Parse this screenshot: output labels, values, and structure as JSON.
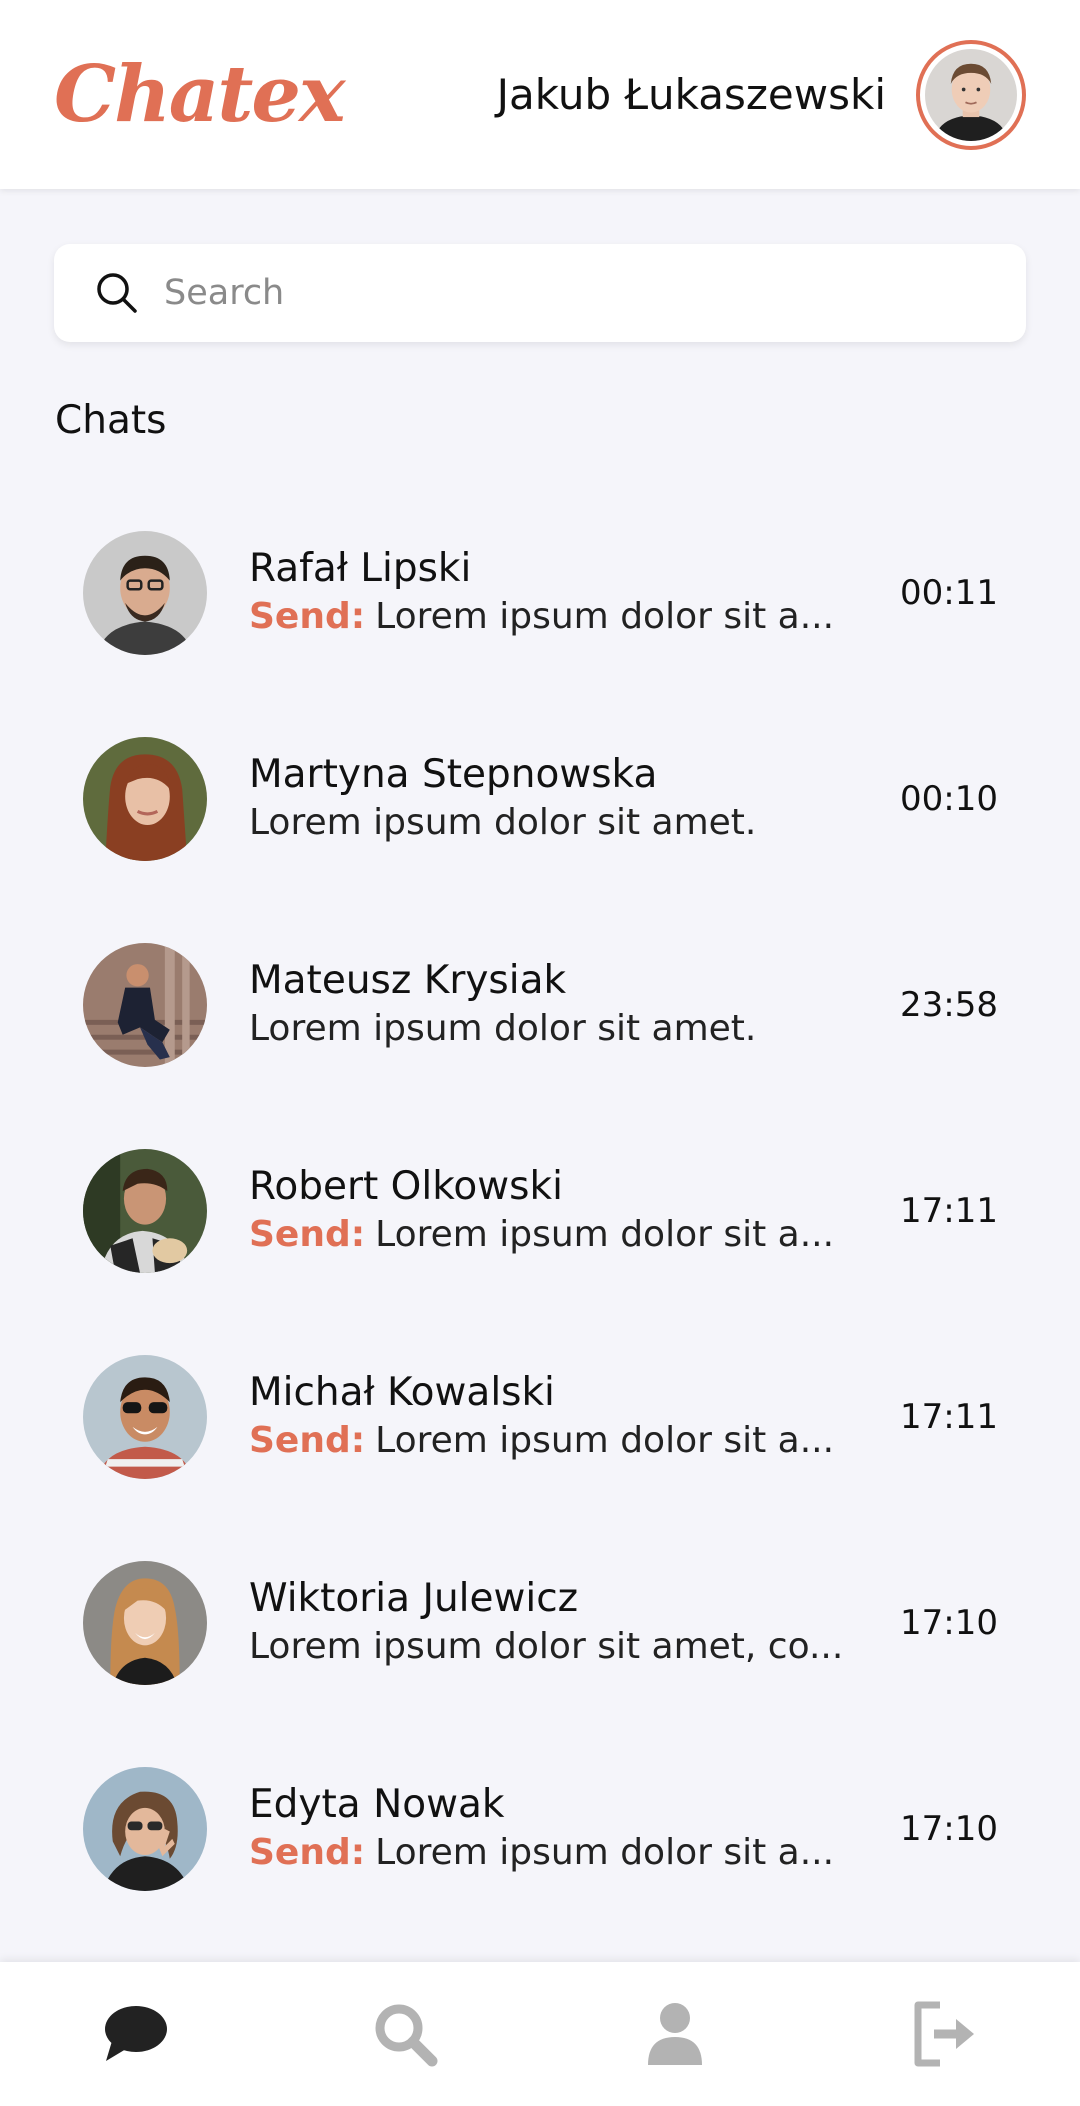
{
  "app": {
    "logo": "Chatex"
  },
  "colors": {
    "accent": "#e07055",
    "background": "#f5f5fa",
    "nav_active": "#222222",
    "nav_inactive": "#b3b3b3"
  },
  "user": {
    "name": "Jakub Łukaszewski",
    "avatar_icon": "profile-avatar"
  },
  "search": {
    "placeholder": "Search",
    "icon": "search-icon"
  },
  "section": {
    "title": "Chats"
  },
  "chats": [
    {
      "name": "Rafał Lipski",
      "prefix": "Send:",
      "preview": "Lorem ipsum dolor sit a...",
      "time": "00:11"
    },
    {
      "name": "Martyna Stepnowska",
      "prefix": "",
      "preview": "Lorem ipsum dolor sit amet.",
      "time": "00:10"
    },
    {
      "name": "Mateusz Krysiak",
      "prefix": "",
      "preview": "Lorem ipsum dolor sit amet.",
      "time": "23:58"
    },
    {
      "name": "Robert Olkowski",
      "prefix": "Send:",
      "preview": "Lorem ipsum dolor sit a...",
      "time": "17:11"
    },
    {
      "name": "Michał Kowalski",
      "prefix": "Send:",
      "preview": "Lorem ipsum dolor sit a...",
      "time": "17:11"
    },
    {
      "name": "Wiktoria Julewicz",
      "prefix": "",
      "preview": "Lorem ipsum dolor sit amet, co...",
      "time": "17:10"
    },
    {
      "name": "Edyta Nowak",
      "prefix": "Send:",
      "preview": "Lorem ipsum dolor sit a...",
      "time": "17:10"
    }
  ],
  "nav": [
    {
      "id": "chats",
      "icon": "chat-bubble-icon",
      "active": true
    },
    {
      "id": "search",
      "icon": "search-icon",
      "active": false
    },
    {
      "id": "profile",
      "icon": "user-icon",
      "active": false
    },
    {
      "id": "logout",
      "icon": "logout-icon",
      "active": false
    }
  ]
}
